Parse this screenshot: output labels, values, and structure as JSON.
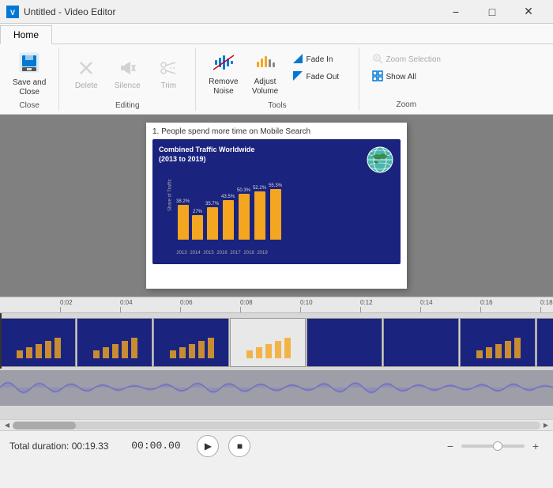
{
  "titlebar": {
    "title": "Untitled - Video Editor",
    "app_icon": "V",
    "minimize": "−",
    "maximize": "□",
    "close": "✕"
  },
  "ribbon": {
    "tabs": [
      {
        "id": "home",
        "label": "Home",
        "active": true
      }
    ],
    "groups": [
      {
        "id": "close",
        "label": "Close",
        "items": [
          {
            "id": "save-close",
            "label": "Save and\nClose",
            "icon": "💾",
            "type": "large"
          }
        ]
      },
      {
        "id": "editing",
        "label": "Editing",
        "items": [
          {
            "id": "delete",
            "label": "Delete",
            "icon": "✕",
            "type": "large",
            "disabled": true
          },
          {
            "id": "silence",
            "label": "Silence",
            "icon": "🔇",
            "type": "large",
            "disabled": true
          },
          {
            "id": "trim",
            "label": "Trim",
            "icon": "✂",
            "type": "large",
            "disabled": true
          }
        ]
      },
      {
        "id": "tools",
        "label": "Tools",
        "items": [
          {
            "id": "remove-noise",
            "label": "Remove\nNoise",
            "icon": "🎚",
            "type": "large"
          },
          {
            "id": "adjust-volume",
            "label": "Adjust\nVolume",
            "icon": "🔊",
            "type": "large"
          },
          {
            "id": "fade-in",
            "label": "Fade In",
            "icon": "◁",
            "type": "small"
          },
          {
            "id": "fade-out",
            "label": "Fade Out",
            "icon": "▷",
            "type": "small"
          }
        ]
      },
      {
        "id": "zoom",
        "label": "Zoom",
        "items": [
          {
            "id": "zoom-selection",
            "label": "Zoom Selection",
            "icon": "🔍",
            "type": "small",
            "disabled": true
          },
          {
            "id": "show-all",
            "label": "Show All",
            "icon": "⊞",
            "type": "small"
          }
        ]
      }
    ]
  },
  "preview": {
    "slide_title": "1. People spend more time on Mobile Search",
    "chart": {
      "title": "Combined Traffic Worldwide\n(2013 to 2019)",
      "bars": [
        38.2,
        27.0,
        35.7,
        43.5,
        50.3,
        52.2,
        55.3
      ],
      "labels": [
        "2013",
        "2014",
        "2015",
        "2016",
        "2017",
        "2018",
        "2019"
      ],
      "y_label": "Share of Traffic"
    }
  },
  "timeline": {
    "marks": [
      "0:02",
      "0:04",
      "0:06",
      "0:08",
      "0:10",
      "0:12",
      "0:14",
      "0:16",
      "0:18"
    ]
  },
  "bottom": {
    "total_duration_label": "Total duration:",
    "total_duration_value": "00:19.33",
    "time_display": "00:00.00",
    "play_label": "▶",
    "stop_label": "■"
  }
}
